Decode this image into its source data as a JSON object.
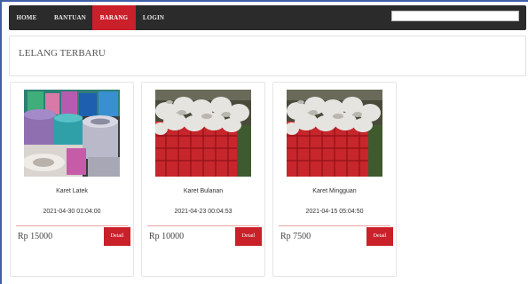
{
  "nav": {
    "items": [
      {
        "label": "HOME"
      },
      {
        "label": "BANTUAN"
      },
      {
        "label": "BARANG"
      },
      {
        "label": "LOGIN"
      }
    ],
    "active_item": "BARANG",
    "search": {
      "value": "",
      "placeholder": ""
    }
  },
  "section": {
    "title": "LELANG TERBARU"
  },
  "products": [
    {
      "name": "Karet Latek",
      "date": "2021-04-30 01:04:00",
      "price": "Rp 15000",
      "button": "Detail",
      "image": "rubber-rolls-photo"
    },
    {
      "name": "Karet Bulanan",
      "date": "2021-04-23 00:04:53",
      "price": "Rp 10000",
      "button": "Detail",
      "image": "rubber-crate-photo"
    },
    {
      "name": "Karet Mingguan",
      "date": "2021-04-15 05:04:50",
      "price": "Rp 7500",
      "button": "Detail",
      "image": "rubber-crate-photo"
    }
  ],
  "colors": {
    "navbar": "#2b2b2b",
    "accent": "#c9202a",
    "frame": "#3f5fa8"
  }
}
